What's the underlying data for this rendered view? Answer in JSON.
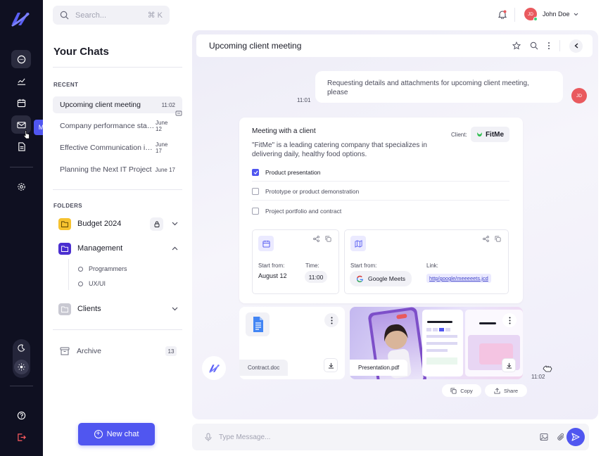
{
  "rail": {
    "tooltip": "Mail",
    "icons": [
      "logo-icon",
      "chat-icon",
      "analytics-icon",
      "calendar-icon",
      "mail-icon",
      "document-icon",
      "settings-icon",
      "moon-icon",
      "sun-icon",
      "help-icon",
      "logout-icon"
    ]
  },
  "search": {
    "placeholder": "Search...",
    "shortcut": "⌘ K"
  },
  "chats": {
    "title": "Your Chats",
    "recent_label": "RECENT",
    "items": [
      {
        "name": "Upcoming client meeting",
        "date": "11:02"
      },
      {
        "name": "Company performance statis...",
        "date": "June 12"
      },
      {
        "name": "Effective Communication in V...",
        "date": "June 17"
      },
      {
        "name": "Planning the Next IT Project",
        "date": "June 17"
      }
    ],
    "folders_label": "FOLDERS",
    "folders": [
      {
        "name": "Budget 2024",
        "color": "#f6c22f"
      },
      {
        "name": "Management",
        "color": "#4b2fd0",
        "subfolders": [
          "Programmers",
          "UX/UI"
        ]
      },
      {
        "name": "Clients",
        "color": "#c9c9d2"
      }
    ],
    "archive": {
      "label": "Archive",
      "count": "13"
    },
    "new_chat": "New chat"
  },
  "user": {
    "initials": "JD",
    "name": "John Doe"
  },
  "conversation": {
    "title": "Upcoming client meeting",
    "request": "Requesting details and attachments for upcoming client meeting, please",
    "request_time": "11:01",
    "reply_time": "11:02",
    "card": {
      "title": "Meeting with a client",
      "description": "\"FitMe\" is a leading catering company that specializes in delivering daily, healthy food options.",
      "client_label": "Client:",
      "client": "FitMe",
      "tasks": [
        {
          "label": "Product presentation",
          "checked": true
        },
        {
          "label": "Prototype or product demonstration",
          "checked": false
        },
        {
          "label": "Project portfolio and contract",
          "checked": false
        }
      ],
      "date_box": {
        "start_label": "Start from:",
        "start": "August 12",
        "time_label": "Time:",
        "time": "11:00"
      },
      "place_box": {
        "start_label": "Start from:",
        "start": "Google Meets",
        "link_label": "Link:",
        "link": "http/google/meeeeets.jcd"
      }
    },
    "attachments": [
      {
        "name": "Contract.doc"
      },
      {
        "name": "Presentation.pdf"
      }
    ],
    "actions": {
      "copy": "Copy",
      "share": "Share"
    },
    "input_placeholder": "Type Message..."
  },
  "colors": {
    "accent": "#5056f0",
    "rail": "#0f1021",
    "avatar": "#e95a5e"
  }
}
